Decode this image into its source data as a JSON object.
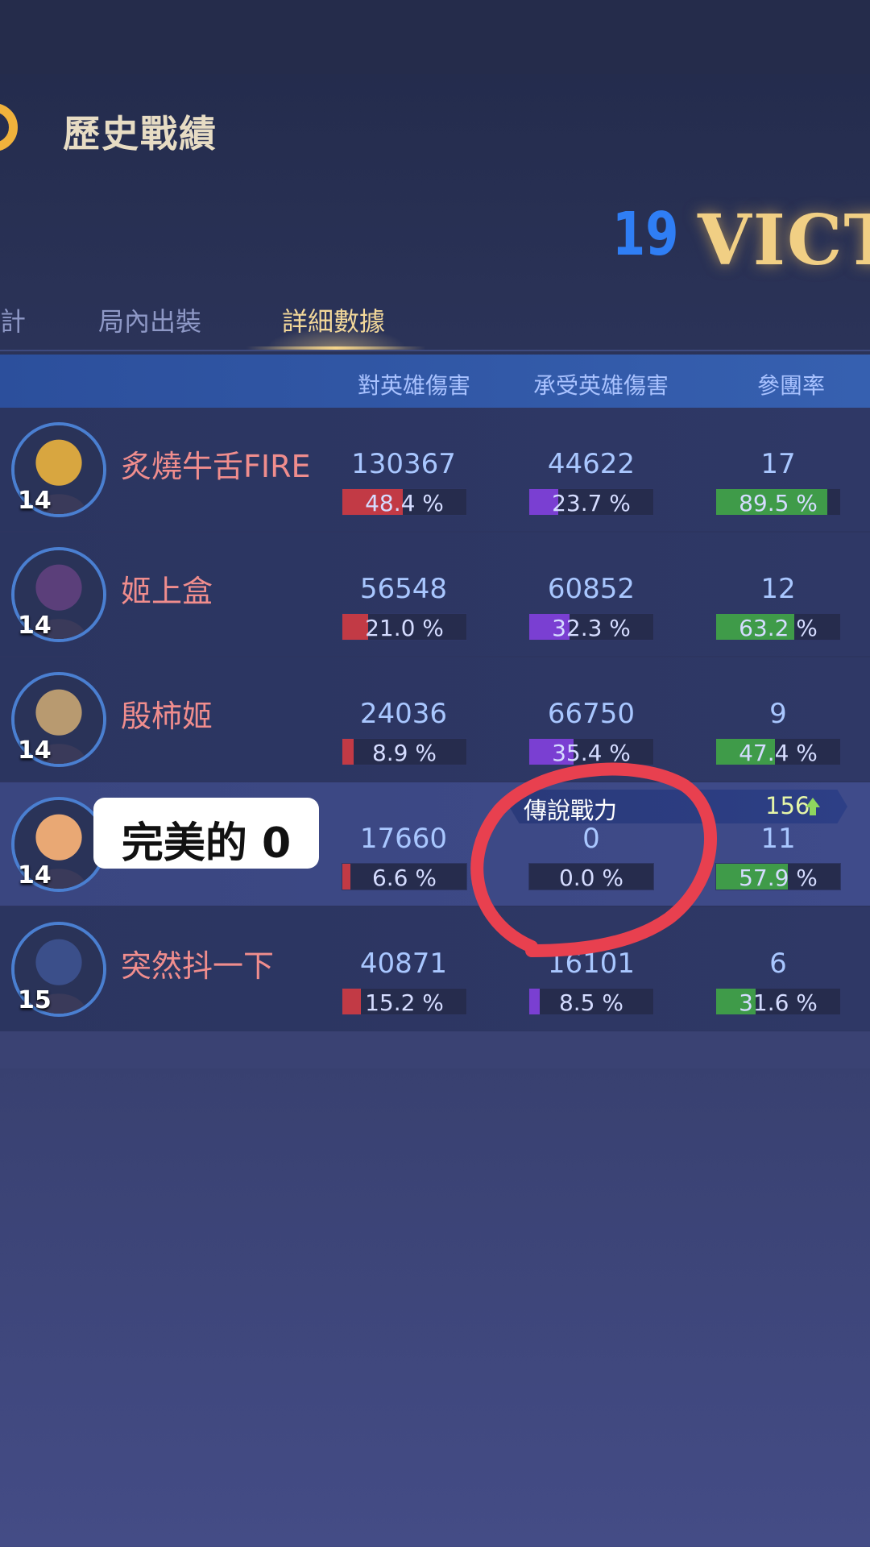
{
  "header": {
    "title": "歷史戰績",
    "score": "19",
    "result": "VICT"
  },
  "tabs": [
    {
      "label": "計",
      "active": false
    },
    {
      "label": "局內出裝",
      "active": false
    },
    {
      "label": "詳細數據",
      "active": true
    }
  ],
  "columns": [
    "對英雄傷害",
    "承受英雄傷害",
    "參團率"
  ],
  "players": [
    {
      "name": "炙燒牛舌FIRE",
      "level": "14",
      "dmg": "130367",
      "dmg_pct": "48.4 %",
      "dmg_frac": 0.484,
      "taken": "44622",
      "taken_pct": "23.7 %",
      "taken_frac": 0.237,
      "kp": "17",
      "kp_pct": "89.5 %",
      "kp_frac": 0.895,
      "avatar_color": "#d8a640"
    },
    {
      "name": "姬上盒",
      "level": "14",
      "dmg": "56548",
      "dmg_pct": "21.0 %",
      "dmg_frac": 0.21,
      "taken": "60852",
      "taken_pct": "32.3 %",
      "taken_frac": 0.323,
      "kp": "12",
      "kp_pct": "63.2 %",
      "kp_frac": 0.632,
      "avatar_color": "#5b3f7a"
    },
    {
      "name": "殷柿姬",
      "level": "14",
      "dmg": "24036",
      "dmg_pct": "8.9 %",
      "dmg_frac": 0.089,
      "taken": "66750",
      "taken_pct": "35.4 %",
      "taken_frac": 0.354,
      "kp": "9",
      "kp_pct": "47.4 %",
      "kp_frac": 0.474,
      "avatar_color": "#b89a70"
    },
    {
      "name": "",
      "level": "14",
      "dmg": "17660",
      "dmg_pct": "6.6 %",
      "dmg_frac": 0.066,
      "taken": "0",
      "taken_pct": "0.0 %",
      "taken_frac": 0.0,
      "kp": "11",
      "kp_pct": "57.9 %",
      "kp_frac": 0.579,
      "avatar_color": "#e9a874"
    },
    {
      "name": "突然抖一下",
      "level": "15",
      "dmg": "40871",
      "dmg_pct": "15.2 %",
      "dmg_frac": 0.152,
      "taken": "16101",
      "taken_pct": "8.5 %",
      "taken_frac": 0.085,
      "kp": "6",
      "kp_pct": "31.6 %",
      "kp_frac": 0.316,
      "avatar_color": "#3b4f8a"
    }
  ],
  "power_banner": {
    "label": "傳說戰力",
    "value": "156"
  },
  "sticker": {
    "text": "完美的 0"
  },
  "colors": {
    "damage_bar": "#c23a45",
    "taken_bar": "#7a3fd2",
    "kp_bar": "#3f9b49",
    "annotation": "#e8404f"
  }
}
